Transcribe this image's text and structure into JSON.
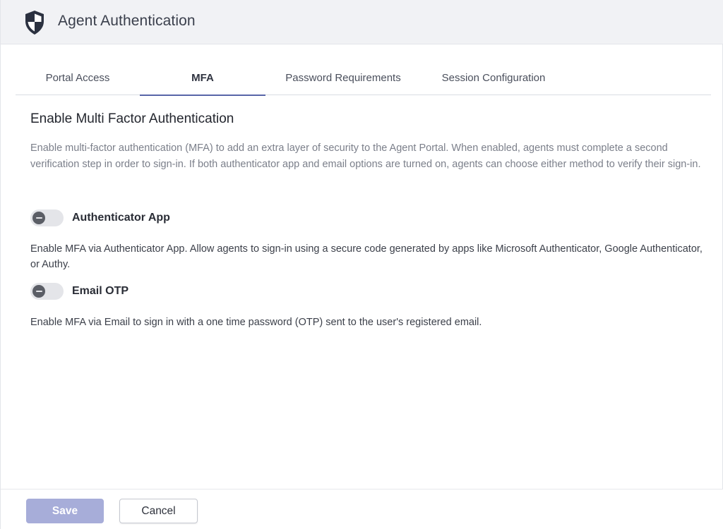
{
  "header": {
    "title": "Agent Authentication",
    "icon": "shield-icon"
  },
  "tabs": [
    {
      "label": "Portal Access",
      "active": false
    },
    {
      "label": "MFA",
      "active": true
    },
    {
      "label": "Password Requirements",
      "active": false
    },
    {
      "label": "Session Configuration",
      "active": false
    }
  ],
  "section": {
    "title": "Enable Multi Factor Authentication",
    "description": "Enable multi-factor authentication (MFA) to add an extra layer of security to the Agent Portal. When enabled, agents must complete a second verification step in order to sign-in. If both authenticator app and email options are turned on, agents can choose either method to verify their sign-in."
  },
  "options": [
    {
      "label": "Authenticator App",
      "enabled": false,
      "description": "Enable MFA via Authenticator App. Allow agents to sign-in using a secure code generated by apps like Microsoft Authenticator, Google Authenticator, or Authy."
    },
    {
      "label": "Email OTP",
      "enabled": false,
      "description": "Enable MFA via Email to sign in with a one time password (OTP) sent to the user's registered email."
    }
  ],
  "footer": {
    "save_label": "Save",
    "cancel_label": "Cancel",
    "save_disabled": true
  },
  "colors": {
    "accent": "#5865a8",
    "shield": "#2b3140",
    "save_disabled_bg": "#a7add9"
  }
}
